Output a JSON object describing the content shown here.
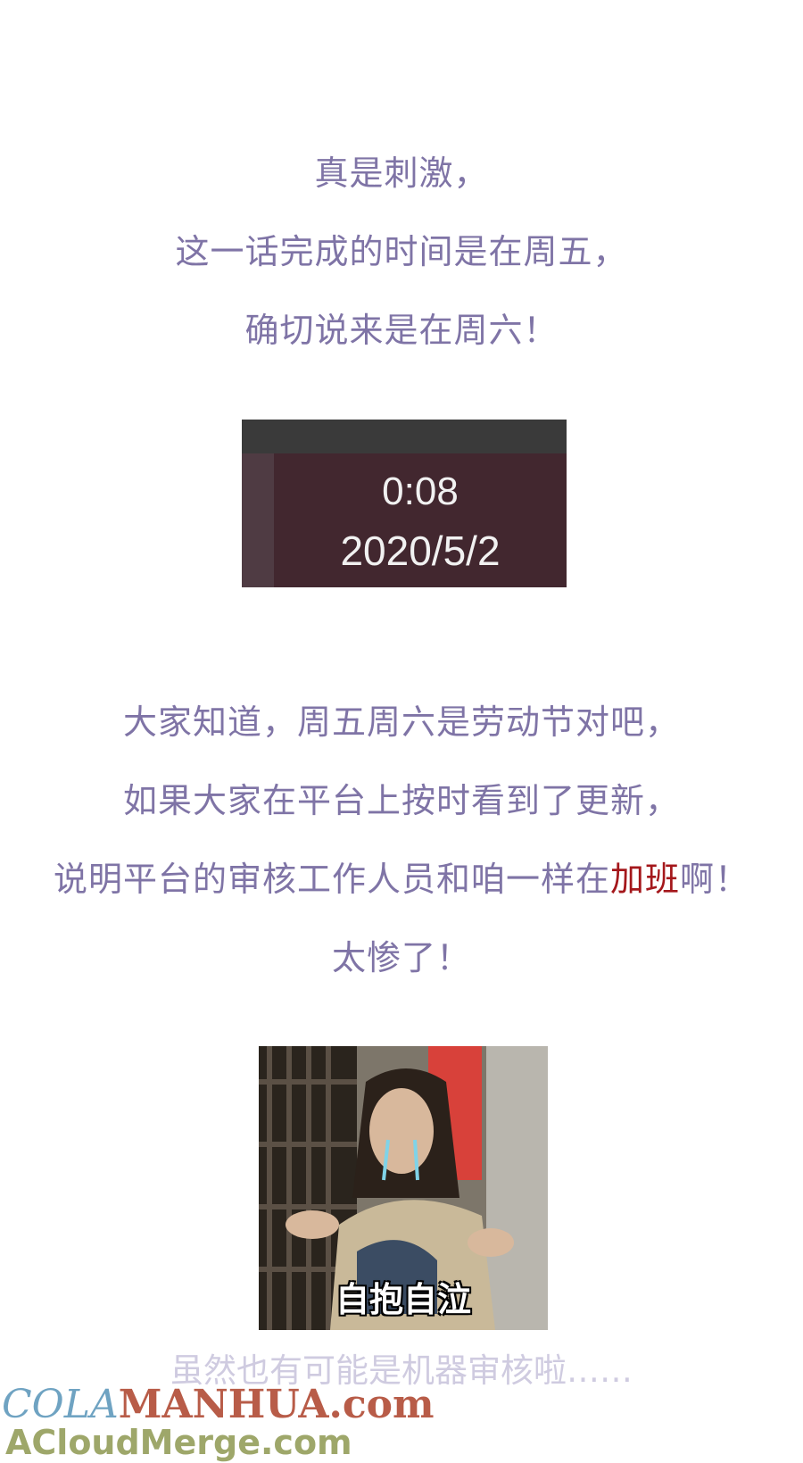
{
  "paragraph1": {
    "lines": [
      "真是刺激，",
      "这一话完成的时间是在周五，",
      "确切说来是在周六！"
    ]
  },
  "clock_image": {
    "time": "0:08",
    "date": "2020/5/2"
  },
  "paragraph2": {
    "line1": "大家知道，周五周六是劳动节对吧，",
    "line2": "如果大家在平台上按时看到了更新，",
    "line3_before": "说明平台的审核工作人员和咱一样在",
    "line3_highlight": "加班",
    "line3_after": "啊！",
    "line4": "太惨了！"
  },
  "meme": {
    "caption": "自抱自泣"
  },
  "note": "虽然也有可能是机器审核啦……",
  "watermark": {
    "part1": "COLA",
    "part2": "MANHUA.com",
    "line2": "ACloudMerge.com"
  },
  "colors": {
    "text": "#7f74a6",
    "highlight": "#a4171b",
    "clock_bg": "#42272f"
  }
}
